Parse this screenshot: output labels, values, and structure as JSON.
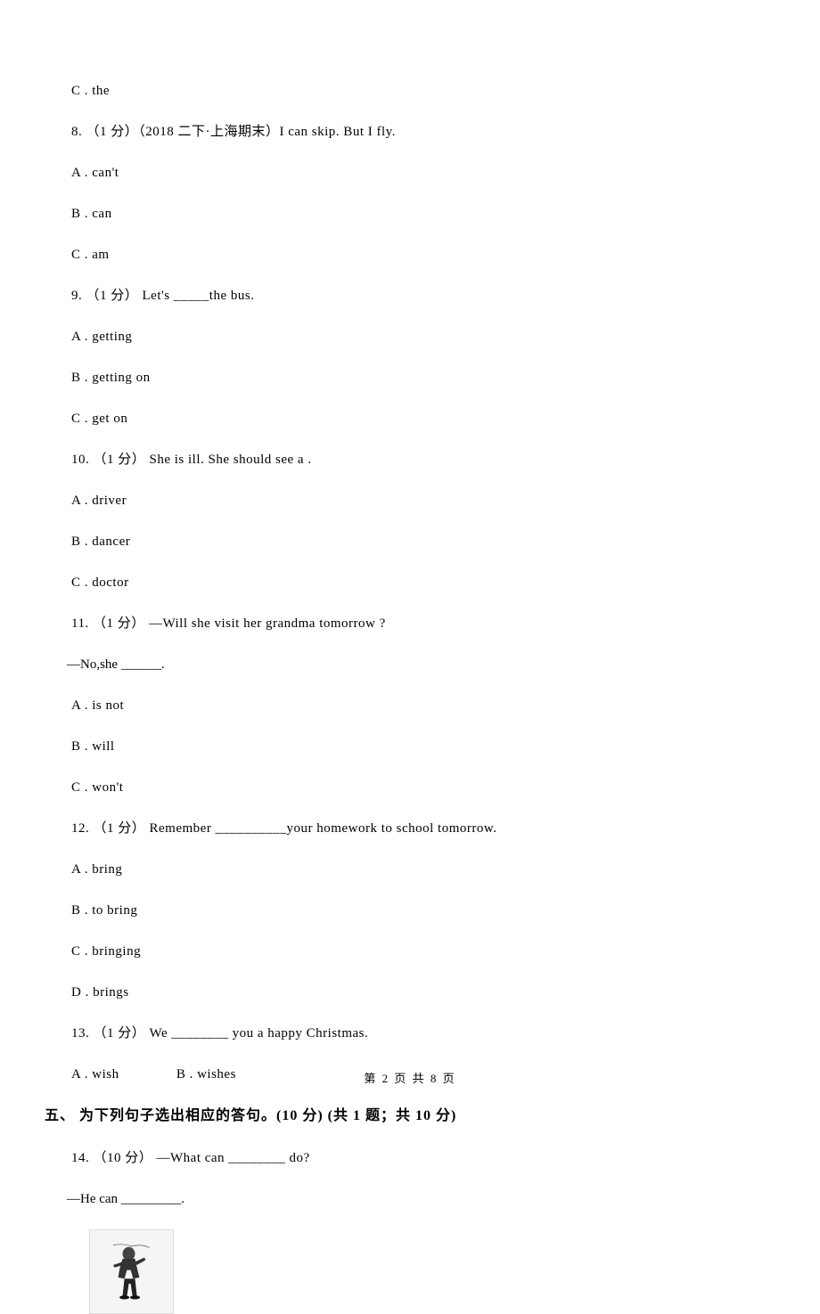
{
  "q7_option_c": "C . the",
  "q8_stem": "8. （1 分）（2018 二下·上海期末）I can skip. But I           fly.",
  "q8_a": "A . can't",
  "q8_b": "B . can",
  "q8_c": "C . am",
  "q9_stem": "9. （1 分） Let's _____the bus.",
  "q9_a": "A . getting",
  "q9_b": "B . getting on",
  "q9_c": "C . get on",
  "q10_stem": "10. （1 分） She is ill. She should see a          .",
  "q10_a": "A . driver",
  "q10_b": "B . dancer",
  "q10_c": "C . doctor",
  "q11_stem": "11. （1 分） —Will she visit her grandma tomorrow ?",
  "q11_response": "—No,she ______.",
  "q11_a": "A . is not",
  "q11_b": "B . will",
  "q11_c": "C . won't",
  "q12_stem": "12. （1 分） Remember __________your homework to school tomorrow.",
  "q12_a": "A . bring",
  "q12_b": "B . to bring",
  "q12_c": "C . bringing",
  "q12_d": "D . brings",
  "q13_stem": "13. （1 分） We ________ you a happy Christmas.",
  "q13_a": "A . wish",
  "q13_b": "B . wishes",
  "section5_header": "五、 为下列句子选出相应的答句。(10 分) (共 1 题；共 10 分)",
  "q14_stem": "14. （10 分） —What can ________ do?",
  "q14_response": "—He can _________.",
  "page_info": "第 2 页 共 8 页"
}
